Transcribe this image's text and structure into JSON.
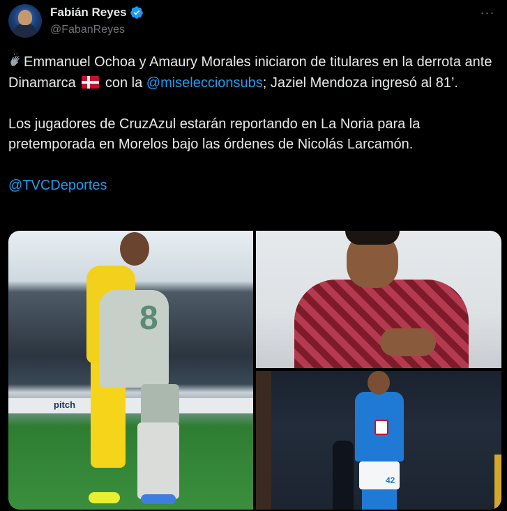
{
  "author": {
    "display_name": "Fabián Reyes",
    "handle": "@FabanReyes",
    "verified": true,
    "avatar_icon": "avatar-image"
  },
  "menu": {
    "icon": "more-options-icon",
    "label": "···"
  },
  "tweet": {
    "line1_prefix_icon": "clapping-hands-icon",
    "line1_text_a": "Emmanuel Ochoa y Amaury Morales iniciaron de titulares en la derrota ante Dinamarca",
    "flag_icon": "denmark-flag-icon",
    "line1_text_b": "con la",
    "mention": "@miseleccionsubs",
    "line1_text_c": "; Jaziel Mendoza ingresó al 81’.",
    "paragraph2": "Los jugadores de CruzAzul estarán reportando en La Noria para la pretemporada en Morelos bajo las órdenes de Nicolás Larcamón.",
    "mention2": "@TVCDeportes"
  },
  "media": {
    "image1": {
      "jersey_number": "8",
      "board_text": "pitch"
    },
    "image3": {
      "jersey_number": "42"
    }
  },
  "colors": {
    "background": "#000000",
    "text": "#e7e9ea",
    "secondary": "#71767b",
    "link": "#1d9bf0",
    "verified": "#1d9bf0"
  }
}
